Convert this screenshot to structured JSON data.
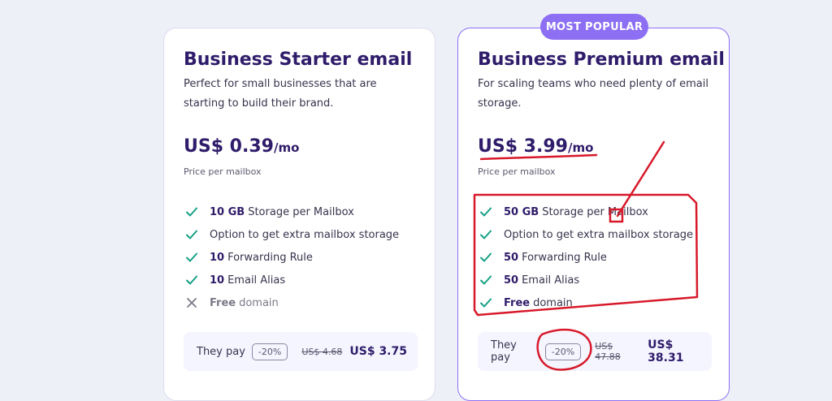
{
  "badge": "MOST POPULAR",
  "plans": [
    {
      "title": "Business Starter email",
      "description": "Perfect for small businesses that are starting to build their brand.",
      "price": "US$ 0.39",
      "per": "/mo",
      "price_note": "Price per mailbox",
      "features": [
        {
          "bold": "10 GB",
          "text": "Storage per Mailbox",
          "included": true
        },
        {
          "bold": "",
          "text": "Option to get extra mailbox storage",
          "included": true
        },
        {
          "bold": "10",
          "text": "Forwarding Rule",
          "included": true
        },
        {
          "bold": "10",
          "text": "Email Alias",
          "included": true
        },
        {
          "bold": "Free",
          "text": "domain",
          "included": false
        }
      ],
      "pay_label": "They pay",
      "discount": "-20%",
      "old_price": "US$ 4.68",
      "new_price": "US$ 3.75"
    },
    {
      "title": "Business Premium email",
      "description": "For scaling teams who need plenty of email storage.",
      "price": "US$ 3.99",
      "per": "/mo",
      "price_note": "Price per mailbox",
      "features": [
        {
          "bold": "50 GB",
          "text": "Storage per Mailbox",
          "included": true
        },
        {
          "bold": "",
          "text": "Option to get extra mailbox storage",
          "included": true
        },
        {
          "bold": "50",
          "text": "Forwarding Rule",
          "included": true
        },
        {
          "bold": "50",
          "text": "Email Alias",
          "included": true
        },
        {
          "bold": "Free",
          "text": "domain",
          "included": true
        }
      ],
      "pay_label": "They pay",
      "discount": "-20%",
      "old_price": "US$ 47.88",
      "new_price": "US$ 38.31"
    }
  ],
  "colors": {
    "background": "#eef0f8",
    "accent": "#8c6ff3",
    "heading": "#2f1c6a",
    "check": "#16a085",
    "annotation": "#d7192a"
  },
  "icons": {
    "included": "check-icon",
    "excluded": "x-icon"
  }
}
